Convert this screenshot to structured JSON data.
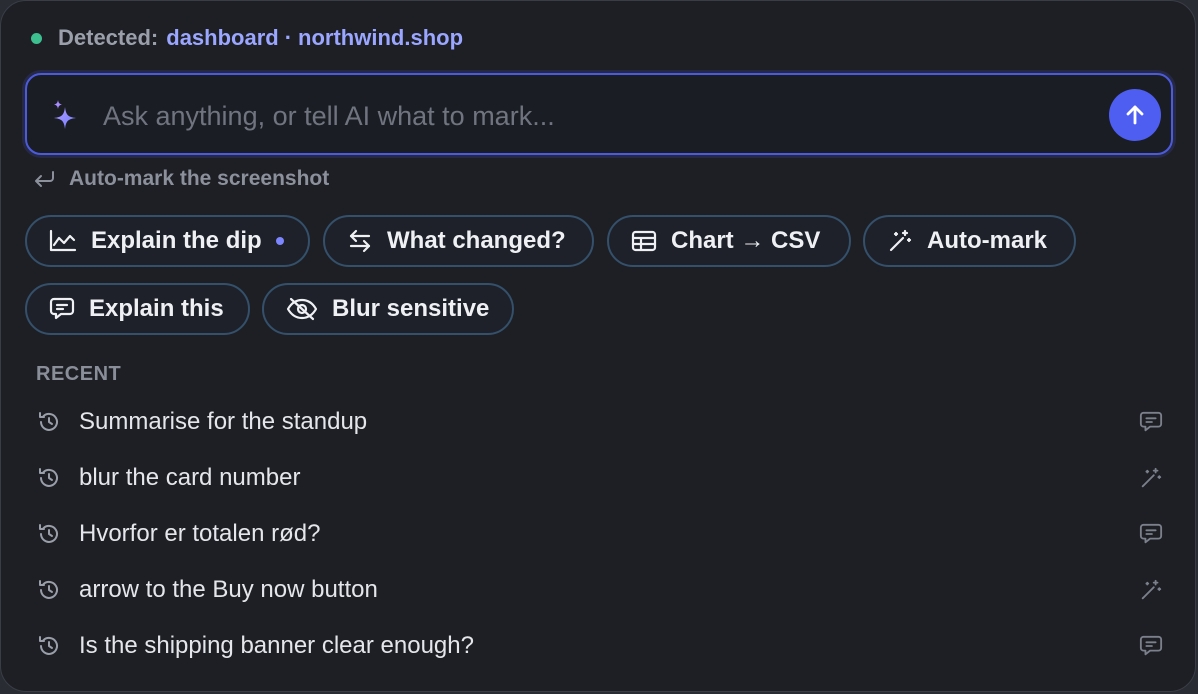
{
  "colors": {
    "status_dot": "#3dbf8f",
    "accent": "#4d5ef0",
    "new_dot": "#7c86ff"
  },
  "header": {
    "label": "Detected:",
    "context": "dashboard",
    "separator": "·",
    "site": "northwind.shop"
  },
  "ask": {
    "icon": "sparkles-icon",
    "placeholder": "Ask anything, or tell AI what to mark...",
    "value": "",
    "send_icon": "arrow-up-icon"
  },
  "hint": {
    "icon": "enter-return-icon",
    "text": "Auto-mark the screenshot"
  },
  "actions": [
    {
      "label": "Explain the dip",
      "icon": "chart-line-icon"
    },
    {
      "label": "What changed?",
      "icon": "swap-arrows-icon"
    },
    {
      "label": "Chart → CSV",
      "icon": "table-icon"
    },
    {
      "label": "Auto-mark",
      "icon": "magic-wand-icon"
    },
    {
      "label": "Explain this",
      "icon": "chat-bubble-icon"
    },
    {
      "label": "Blur sensitive",
      "icon": "eye-slash-icon"
    }
  ],
  "recent": {
    "title": "RECENT",
    "items": [
      {
        "text": "Summarise for the standup",
        "type_icon": "chat-bubble-icon"
      },
      {
        "text": "blur the card number",
        "type_icon": "magic-wand-icon"
      },
      {
        "text": "Hvorfor er totalen rød?",
        "type_icon": "chat-bubble-icon"
      },
      {
        "text": "arrow to the Buy now button",
        "type_icon": "magic-wand-icon"
      },
      {
        "text": "Is the shipping banner clear enough?",
        "type_icon": "chat-bubble-icon"
      }
    ]
  }
}
